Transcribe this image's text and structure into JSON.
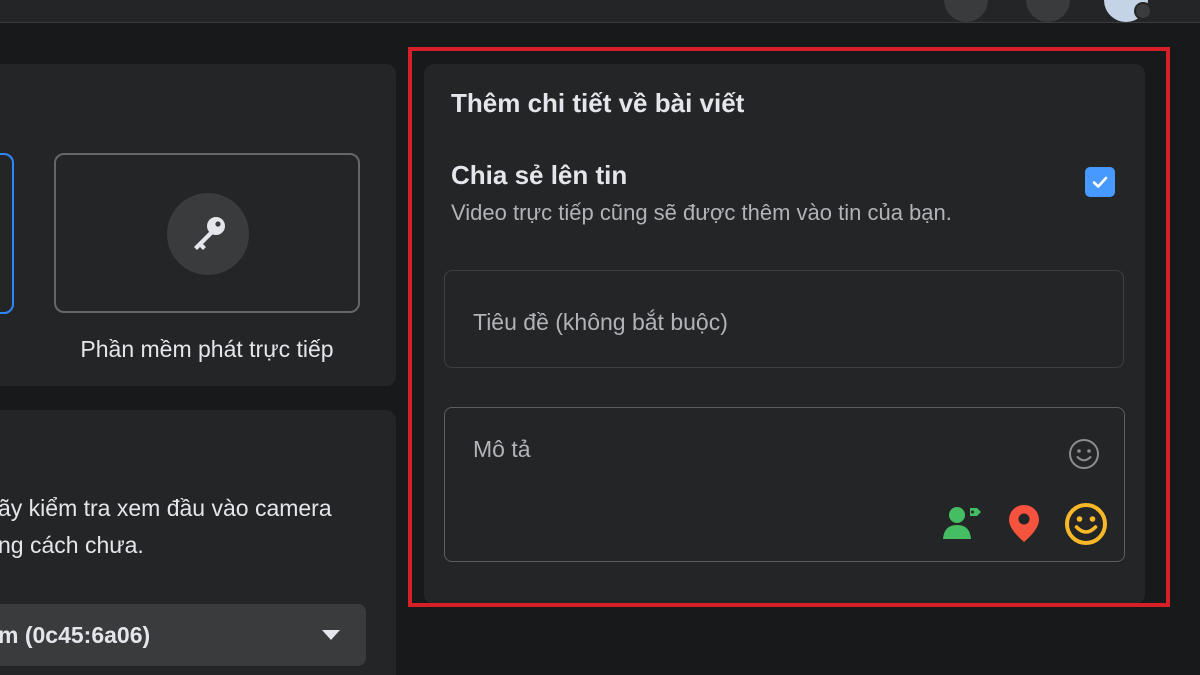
{
  "left": {
    "option_label": "Phần mềm phát trực tiếp",
    "camera_text_line1": "ãy kiểm tra xem đầu vào camera",
    "camera_text_line2": "ng cách chưa.",
    "camera_select_value": "m (0c45:6a06)"
  },
  "details": {
    "title": "Thêm chi tiết về bài viết",
    "share_title": "Chia sẻ lên tin",
    "share_description": "Video trực tiếp cũng sẽ được thêm vào tin của bạn.",
    "share_checked": true,
    "title_placeholder": "Tiêu đề (không bắt buộc)",
    "description_placeholder": "Mô tả"
  },
  "icons": {
    "key": "key-icon",
    "checkmark": "checkmark-icon",
    "emoji": "emoji-icon",
    "tag_people": "tag-people-icon",
    "location": "location-pin-icon",
    "feeling": "feeling-icon",
    "dropdown": "chevron-down-icon"
  },
  "colors": {
    "background": "#18191a",
    "panel": "#242526",
    "highlight_border": "#d61f26",
    "checkbox": "#4599ff",
    "tag_green": "#45bd62",
    "pin_red": "#f5533d",
    "feeling_yellow": "#f7b928",
    "selected_blue": "#2d88ff"
  }
}
